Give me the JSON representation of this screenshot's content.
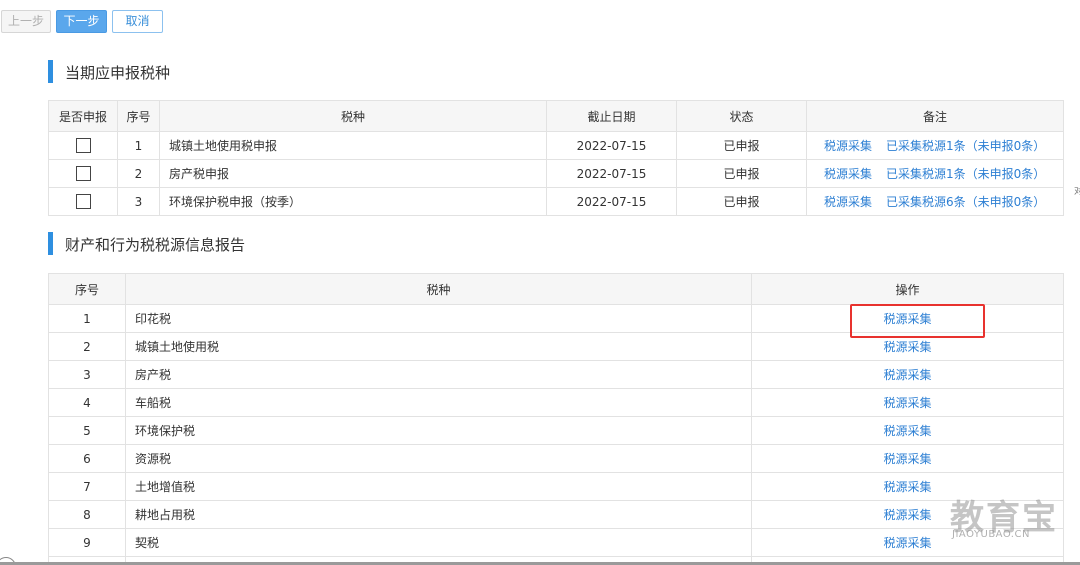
{
  "toolbar": {
    "prev_label": "上一步",
    "next_label": "下一步",
    "cancel_label": "取消"
  },
  "section1": {
    "title": "当期应申报税种",
    "columns": [
      "是否申报",
      "序号",
      "税种",
      "截止日期",
      "状态",
      "备注"
    ],
    "rows": [
      {
        "no": "1",
        "name": "城镇土地使用税申报",
        "date": "2022-07-15",
        "status": "已申报",
        "link": "税源采集",
        "note": "已采集税源1条（未申报0条）"
      },
      {
        "no": "2",
        "name": "房产税申报",
        "date": "2022-07-15",
        "status": "已申报",
        "link": "税源采集",
        "note": "已采集税源1条（未申报0条）"
      },
      {
        "no": "3",
        "name": "环境保护税申报（按季）",
        "date": "2022-07-15",
        "status": "已申报",
        "link": "税源采集",
        "note": "已采集税源6条（未申报0条）"
      }
    ]
  },
  "section2": {
    "title": "财产和行为税税源信息报告",
    "columns": [
      "序号",
      "税种",
      "操作"
    ],
    "rows": [
      {
        "no": "1",
        "name": "印花税",
        "op": "税源采集"
      },
      {
        "no": "2",
        "name": "城镇土地使用税",
        "op": "税源采集"
      },
      {
        "no": "3",
        "name": "房产税",
        "op": "税源采集"
      },
      {
        "no": "4",
        "name": "车船税",
        "op": "税源采集"
      },
      {
        "no": "5",
        "name": "环境保护税",
        "op": "税源采集"
      },
      {
        "no": "6",
        "name": "资源税",
        "op": "税源采集"
      },
      {
        "no": "7",
        "name": "土地增值税",
        "op": "税源采集"
      },
      {
        "no": "8",
        "name": "耕地占用税",
        "op": "税源采集"
      },
      {
        "no": "9",
        "name": "契税",
        "op": "税源采集"
      }
    ]
  },
  "watermark": {
    "brand": "教育宝",
    "domain": "JIAOYUBAO.CN"
  },
  "edge_mark": "对",
  "colors": {
    "accent": "#2e8fe0",
    "link": "#2d7fd3",
    "highlight": "#e8322e",
    "next_button": "#5aa7ec"
  }
}
